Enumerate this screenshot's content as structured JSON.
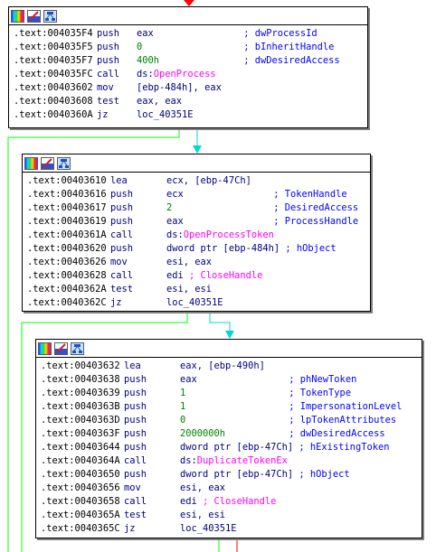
{
  "colors": {
    "address": "#000000",
    "mnemonic": "#000080",
    "number": "#008000",
    "imported_call": "#ff00ff",
    "comment": "#0000ff",
    "edge_true": "#00ff00",
    "edge_false": "#ff0000",
    "edge_normal": "#00c8c8"
  },
  "blocks": [
    {
      "name": "block-1",
      "lines": [
        {
          "addr": ".text:004035F4",
          "mn": "push",
          "op": "eax",
          "cmt": "; dwProcessId"
        },
        {
          "addr": ".text:004035F5",
          "mn": "push",
          "op": "0",
          "op_kind": "num",
          "cmt": "; bInheritHandle"
        },
        {
          "addr": ".text:004035F7",
          "mn": "push",
          "op": "400h",
          "op_kind": "num",
          "cmt": "; dwDesiredAccess"
        },
        {
          "addr": ".text:004035FC",
          "mn": "call",
          "op_prefix": "ds:",
          "op": "OpenProcess",
          "op_kind": "call"
        },
        {
          "addr": ".text:00403602",
          "mn": "mov",
          "op": "[ebp-484h], eax"
        },
        {
          "addr": ".text:00403608",
          "mn": "test",
          "op": "eax, eax"
        },
        {
          "addr": ".text:0040360A",
          "mn": "jz",
          "op": "loc_40351E"
        }
      ]
    },
    {
      "name": "block-2",
      "lines": [
        {
          "addr": ".text:00403610",
          "mn": "lea",
          "op": "ecx, [ebp-47Ch]"
        },
        {
          "addr": ".text:00403616",
          "mn": "push",
          "op": "ecx",
          "cmt": "; TokenHandle"
        },
        {
          "addr": ".text:00403617",
          "mn": "push",
          "op": "2",
          "op_kind": "num",
          "cmt": "; DesiredAccess"
        },
        {
          "addr": ".text:00403619",
          "mn": "push",
          "op": "eax",
          "cmt": "; ProcessHandle"
        },
        {
          "addr": ".text:0040361A",
          "mn": "call",
          "op_prefix": "ds:",
          "op": "OpenProcessToken",
          "op_kind": "call"
        },
        {
          "addr": ".text:00403620",
          "mn": "push",
          "op": "dword ptr [ebp-484h]",
          "cmt": "; hObject"
        },
        {
          "addr": ".text:00403626",
          "mn": "mov",
          "op": "esi, eax"
        },
        {
          "addr": ".text:00403628",
          "mn": "call",
          "op_prefix": "edi ",
          "op": "; CloseHandle",
          "op_kind": "call"
        },
        {
          "addr": ".text:0040362A",
          "mn": "test",
          "op": "esi, esi"
        },
        {
          "addr": ".text:0040362C",
          "mn": "jz",
          "op": "loc_40351E"
        }
      ]
    },
    {
      "name": "block-3",
      "lines": [
        {
          "addr": ".text:00403632",
          "mn": "lea",
          "op": "eax, [ebp-490h]"
        },
        {
          "addr": ".text:00403638",
          "mn": "push",
          "op": "eax",
          "cmt": "; phNewToken"
        },
        {
          "addr": ".text:00403639",
          "mn": "push",
          "op": "1",
          "op_kind": "num",
          "cmt": "; TokenType"
        },
        {
          "addr": ".text:0040363B",
          "mn": "push",
          "op": "1",
          "op_kind": "num",
          "cmt": "; ImpersonationLevel"
        },
        {
          "addr": ".text:0040363D",
          "mn": "push",
          "op": "0",
          "op_kind": "num",
          "cmt": "; lpTokenAttributes"
        },
        {
          "addr": ".text:0040363F",
          "mn": "push",
          "op": "2000000h",
          "op_kind": "num",
          "cmt": "; dwDesiredAccess"
        },
        {
          "addr": ".text:00403644",
          "mn": "push",
          "op": "dword ptr [ebp-47Ch]",
          "cmt": "; hExistingToken"
        },
        {
          "addr": ".text:0040364A",
          "mn": "call",
          "op_prefix": "ds:",
          "op": "DuplicateTokenEx",
          "op_kind": "call"
        },
        {
          "addr": ".text:00403650",
          "mn": "push",
          "op": "dword ptr [ebp-47Ch]",
          "cmt": "; hObject"
        },
        {
          "addr": ".text:00403656",
          "mn": "mov",
          "op": "esi, eax"
        },
        {
          "addr": ".text:00403658",
          "mn": "call",
          "op_prefix": "edi ",
          "op": "; CloseHandle",
          "op_kind": "call"
        },
        {
          "addr": ".text:0040365A",
          "mn": "test",
          "op": "esi, esi"
        },
        {
          "addr": ".text:0040365C",
          "mn": "jz",
          "op": "loc_40351E"
        }
      ]
    }
  ]
}
